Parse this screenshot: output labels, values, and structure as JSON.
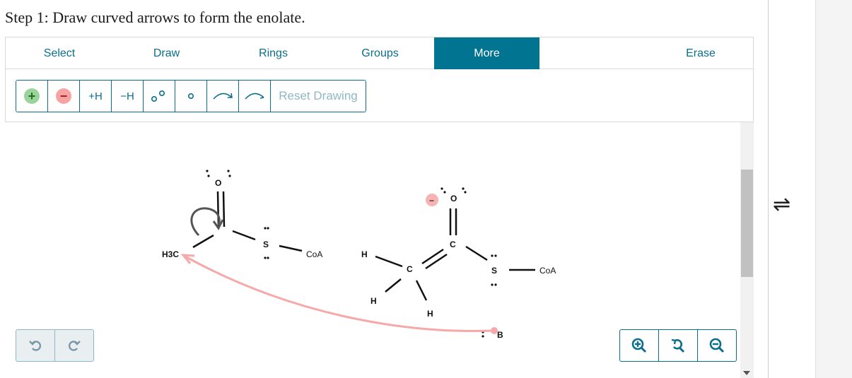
{
  "step_title": "Step 1: Draw curved arrows to form the enolate.",
  "tabs": [
    {
      "label": "Select"
    },
    {
      "label": "Draw"
    },
    {
      "label": "Rings"
    },
    {
      "label": "Groups"
    },
    {
      "label": "More",
      "active": true
    },
    {
      "label": "Erase"
    }
  ],
  "tools": {
    "plus_charge": "+",
    "minus_charge": "−",
    "add_h": "+H",
    "remove_h": "−H",
    "reset": "Reset Drawing"
  },
  "icons": {
    "pair_electrons": "lone-pair-icon",
    "single_electron": "radical-icon",
    "double_arrow": "curved-arrow-double-icon",
    "single_arrow": "curved-arrow-single-icon",
    "undo": "undo-icon",
    "redo": "redo-icon",
    "zoom_in": "zoom-in-icon",
    "zoom_reset": "zoom-reset-icon",
    "zoom_out": "zoom-out-icon"
  },
  "molecules": {
    "left": {
      "o": "O",
      "s": "S",
      "coa": "CoA",
      "h3c": "H3C"
    },
    "right": {
      "o": "O",
      "c_top": "C",
      "c_mid": "C",
      "s": "S",
      "coa": "CoA",
      "h_left": "H",
      "h_bot_left": "H",
      "h_bot": "H",
      "charge": "−"
    },
    "base": "B"
  },
  "equilibrium_symbol": "⇌",
  "colors": {
    "accent": "#007491",
    "arrow_pink": "#f6a9a9",
    "minus_badge": "#f7b3b3",
    "plus_badge": "#9bd49b"
  }
}
